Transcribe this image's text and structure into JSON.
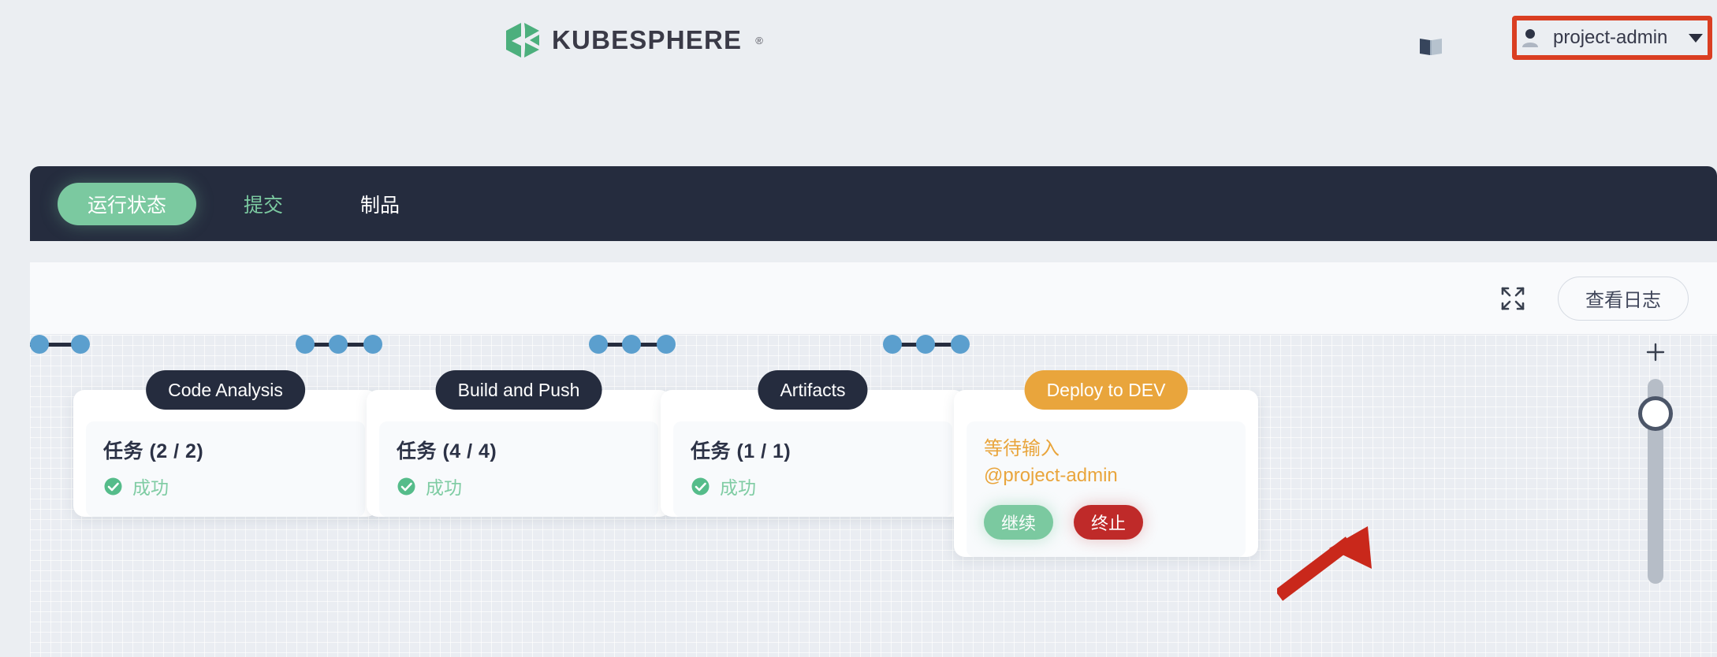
{
  "header": {
    "logo_text": "KUBESPHERE",
    "logo_reg": "®",
    "logo_icon": "kubesphere-hex-logo",
    "doc_icon": "documentation-book-icon",
    "user": {
      "avatar_icon": "user-avatar-icon",
      "name": "project-admin",
      "caret_icon": "chevron-down-icon"
    }
  },
  "tabs": [
    {
      "label": "运行状态",
      "active": true
    },
    {
      "label": "提交",
      "active": false
    },
    {
      "label": "制品",
      "active": false
    }
  ],
  "toolbar": {
    "expand_icon": "fullscreen-expand-icon",
    "view_logs_label": "查看日志"
  },
  "canvas": {
    "zoom_in_icon": "plus-icon",
    "zoom_slider_name": "zoom-slider"
  },
  "pipeline": {
    "stages": [
      {
        "name": "Code Analysis",
        "pill_color": "#252C3E",
        "task_label": "任务 (2 / 2)",
        "status_label": "成功",
        "status_icon": "check-circle-icon",
        "type": "completed"
      },
      {
        "name": "Build and Push",
        "pill_color": "#252C3E",
        "task_label": "任务 (4 / 4)",
        "status_label": "成功",
        "status_icon": "check-circle-icon",
        "type": "completed"
      },
      {
        "name": "Artifacts",
        "pill_color": "#252C3E",
        "task_label": "任务 (1 / 1)",
        "status_label": "成功",
        "status_icon": "check-circle-icon",
        "type": "completed"
      },
      {
        "name": "Deploy to DEV",
        "pill_color": "#E9A53C",
        "pending_line1": "等待输入",
        "pending_line2": "@project-admin",
        "continue_label": "继续",
        "abort_label": "终止",
        "type": "waiting-input"
      }
    ]
  },
  "annotations": {
    "user_menu_box_color": "#DA3E22",
    "arrow_color": "#C9281B",
    "arrow_target": "continue-button"
  }
}
